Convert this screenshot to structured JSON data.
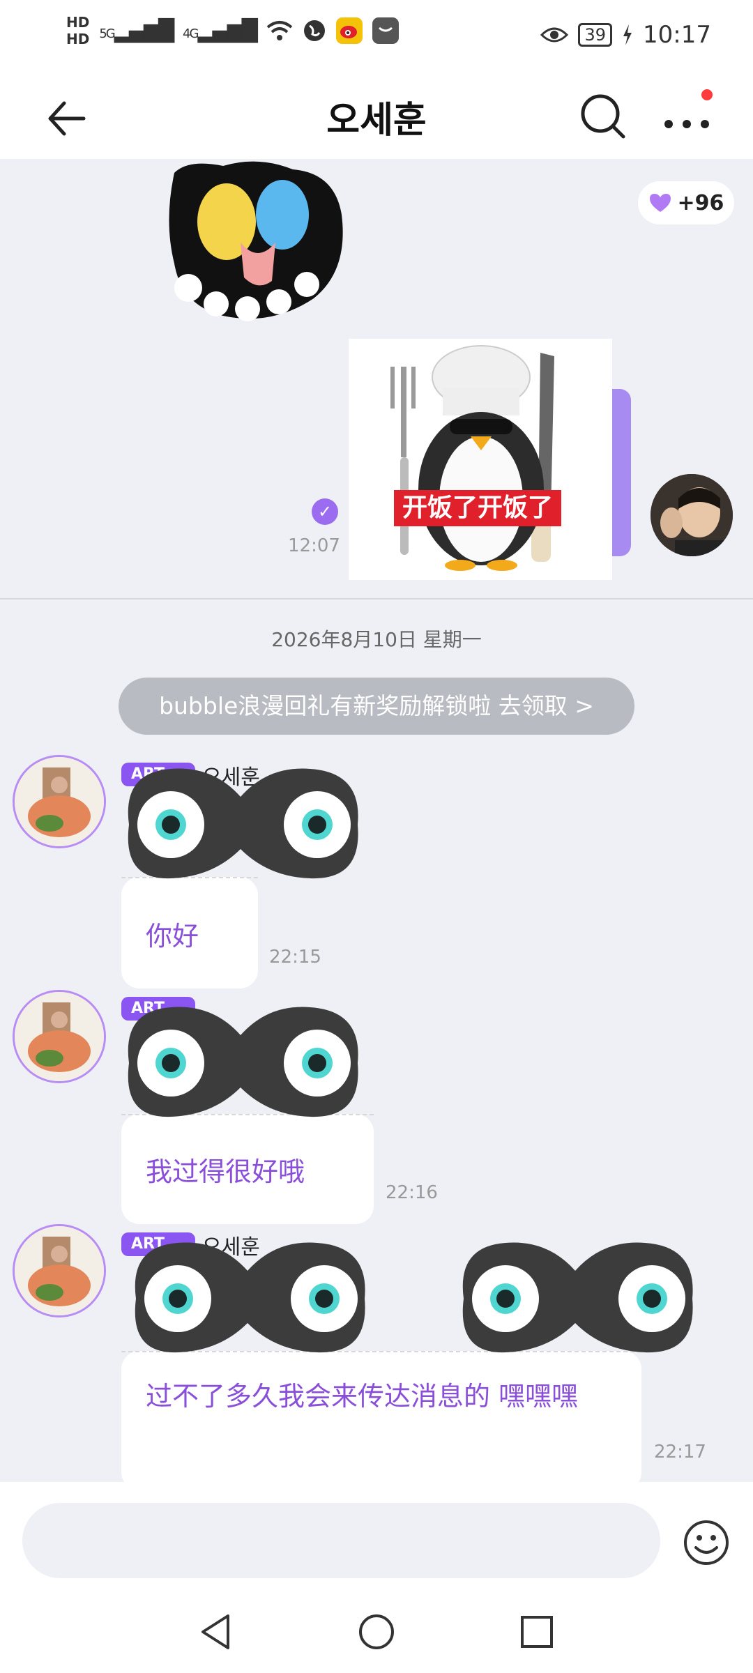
{
  "status_bar": {
    "hd1": "HD",
    "hd2": "HD",
    "sig5g": "5G",
    "sig4g": "4G",
    "battery": "39",
    "time": "10:17"
  },
  "header": {
    "title": "오세훈"
  },
  "top_messages": {
    "likes": "+96",
    "sticker_caption": "开饭了开饭了",
    "time": "12:07"
  },
  "date_divider": "2026年8月10日 星期一",
  "banner": "bubble浪漫回礼有新奖励解锁啦 去领取 >",
  "messages": [
    {
      "badge": "ART",
      "sender": "오세훈",
      "text": "你好",
      "time": "22:15"
    },
    {
      "badge": "ART",
      "sender": "",
      "text": "我过得很好哦",
      "time": "22:16"
    },
    {
      "badge": "ART",
      "sender": "오세훈",
      "text": "过不了多久我会来传达消息的 嘿嘿嘿",
      "time": "22:17"
    }
  ],
  "input": {
    "value": "",
    "placeholder": ""
  },
  "colors": {
    "accent": "#8a55f0",
    "bubble_text": "#8a4fd8",
    "chat_bg": "#eef0f5"
  },
  "icons": [
    "back-arrow-icon",
    "search-icon",
    "more-dots-icon",
    "heart-icon",
    "check-icon",
    "emoji-icon",
    "nav-back-icon",
    "nav-home-icon",
    "nav-recent-icon"
  ]
}
